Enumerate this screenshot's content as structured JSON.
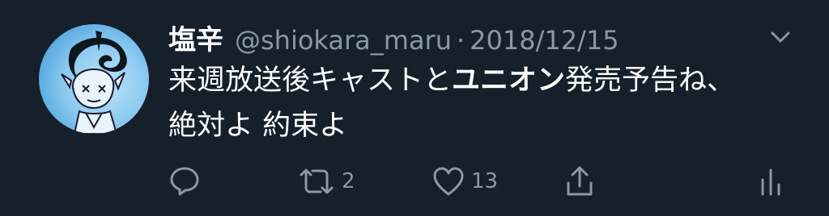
{
  "tweet": {
    "display_name": "塩辛",
    "handle": "@shiokara_maru",
    "separator": "·",
    "date": "2018/12/15",
    "text_line1_before": "来週放送後キャストと",
    "text_line1_bold": "ユニオン",
    "text_line1_after": "発売予告ね、",
    "text_line2": "絶対よ 約束よ"
  },
  "actions": {
    "reply_icon": "reply-icon",
    "retweet_icon": "retweet-icon",
    "retweet_count": "2",
    "like_icon": "heart-icon",
    "like_count": "13",
    "share_icon": "share-icon",
    "stats_icon": "analytics-icon"
  },
  "colors": {
    "background": "#15202b",
    "primary_text": "#ffffff",
    "secondary_text": "#8899a6"
  }
}
